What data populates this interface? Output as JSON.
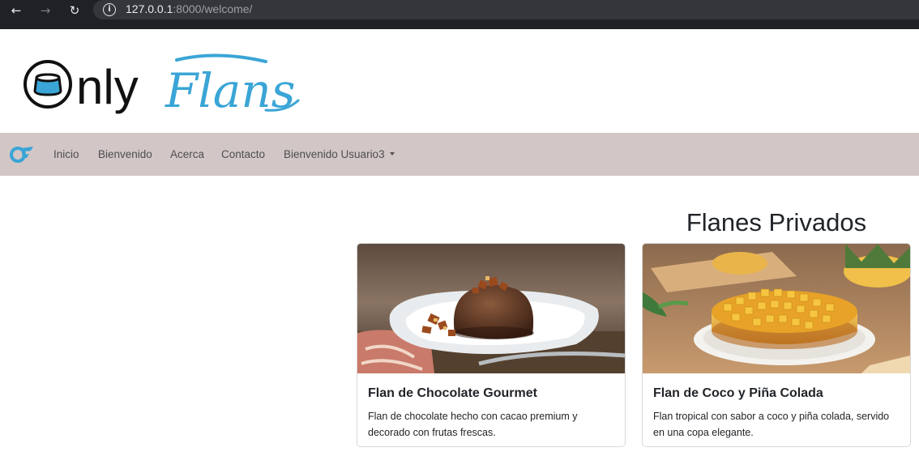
{
  "browser": {
    "url_host": "127.0.0.1",
    "url_rest": ":8000/welcome/",
    "back_icon": "back-arrow-icon",
    "forward_icon": "forward-arrow-icon",
    "reload_icon": "reload-icon",
    "info_icon": "info-icon"
  },
  "logo": {
    "part1": "Only",
    "part2": "Flans",
    "accent_color": "#3aa5d6"
  },
  "navbar": {
    "brand_icon": "onlyflans-brand-icon",
    "items": [
      {
        "label": "Inicio"
      },
      {
        "label": "Bienvenido"
      },
      {
        "label": "Acerca"
      },
      {
        "label": "Contacto"
      },
      {
        "label": "Bienvenido Usuario3",
        "dropdown": true
      }
    ],
    "background": "#d2c6c6"
  },
  "main": {
    "heading": "Flanes Privados",
    "cards": [
      {
        "title": "Flan de Chocolate Gourmet",
        "text": "Flan de chocolate hecho con cacao premium y decorado con frutas frescas.",
        "image": "chocolate-flan-image"
      },
      {
        "title": "Flan de Coco y Piña Colada",
        "text": "Flan tropical con sabor a coco y piña colada, servido en una copa elegante.",
        "image": "coconut-pina-colada-flan-image"
      }
    ]
  }
}
